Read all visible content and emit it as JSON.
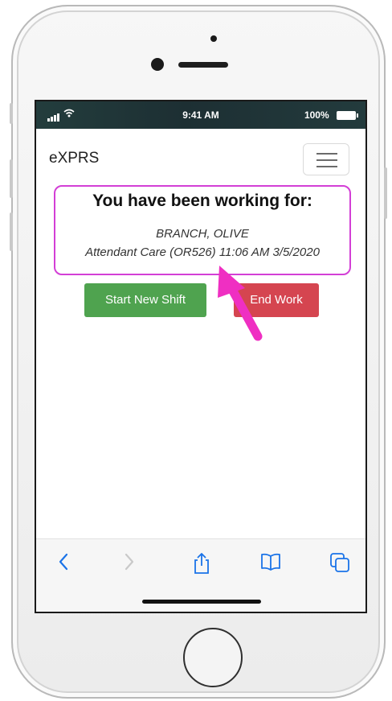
{
  "status_bar": {
    "time": "9:41 AM",
    "battery": "100%"
  },
  "navbar": {
    "brand": "eXPRS"
  },
  "card": {
    "heading": "You have been working for:",
    "client_name": "BRANCH, OLIVE",
    "service_info": "Attendant Care (OR526) 11:06 AM 3/5/2020"
  },
  "buttons": {
    "start_new_shift": "Start New Shift",
    "end_work": "End Work"
  },
  "colors": {
    "annotation": "#d33fd6",
    "start_button": "#4fa34f",
    "end_button": "#d54550",
    "ios_blue": "#1a73e8"
  },
  "toolbar_icons": [
    "back-icon",
    "forward-icon",
    "share-icon",
    "bookmarks-icon",
    "tabs-icon"
  ]
}
